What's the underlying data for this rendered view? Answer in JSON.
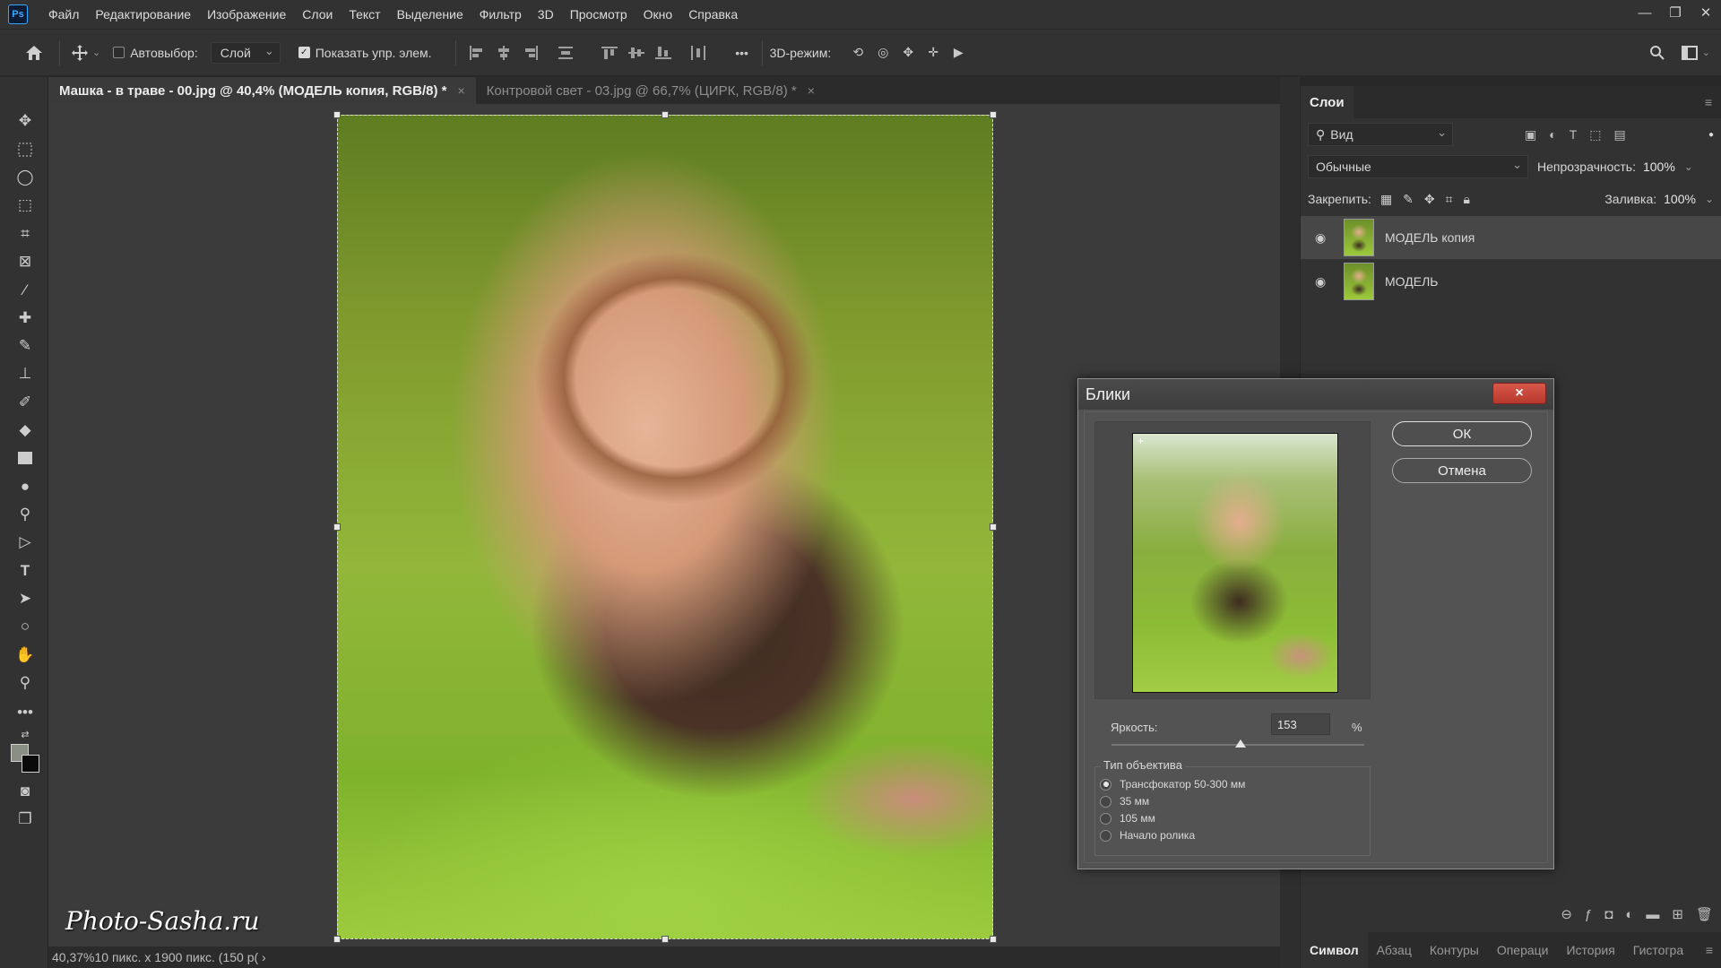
{
  "menu": [
    "Файл",
    "Редактирование",
    "Изображение",
    "Слои",
    "Текст",
    "Выделение",
    "Фильтр",
    "3D",
    "Просмотр",
    "Окно",
    "Справка"
  ],
  "options_bar": {
    "autoselect_label": "Автовыбор:",
    "autoselect_target": "Слой",
    "show_controls_label": "Показать упр. элем.",
    "mode_3d_label": "3D-режим:"
  },
  "tabs": [
    {
      "label": "Машка - в траве - 00.jpg @ 40,4% (МОДЕЛЬ копия, RGB/8) *",
      "close": "×"
    },
    {
      "label": "Контровой свет - 03.jpg @ 66,7% (ЦИРК, RGB/8) *",
      "close": "×"
    }
  ],
  "watermark": "Photo-Sasha.ru",
  "status": {
    "text": "40,37%10 пикс. x 1900 пикс. (150 р( ›"
  },
  "layers_panel": {
    "tab": "Слои",
    "filter_kind": "Вид",
    "blend_mode": "Обычные",
    "opacity_label": "Непрозрачность:",
    "opacity_value": "100%",
    "lock_label": "Закрепить:",
    "fill_label": "Заливка:",
    "fill_value": "100%",
    "layers": [
      {
        "name": "МОДЕЛЬ копия",
        "selected": true
      },
      {
        "name": "МОДЕЛЬ",
        "selected": false
      }
    ]
  },
  "bottom_tabs": [
    "Символ",
    "Абзац",
    "Контуры",
    "Операци",
    "История",
    "Гистогра"
  ],
  "dialog": {
    "title": "Блики",
    "ok_label": "ОК",
    "cancel_label": "Отмена",
    "brightness_label": "Яркость:",
    "brightness_value": "153",
    "brightness_unit": "%",
    "brightness_level": 0.51,
    "lens_group_title": "Тип объектива",
    "lens_options": [
      {
        "label": "Трансфокатор 50-300 мм",
        "selected": true
      },
      {
        "label": "35 мм",
        "selected": false
      },
      {
        "label": "105 мм",
        "selected": false
      },
      {
        "label": "Начало ролика",
        "selected": false
      }
    ]
  },
  "icons": {
    "close": "×",
    "eye": "◉"
  }
}
